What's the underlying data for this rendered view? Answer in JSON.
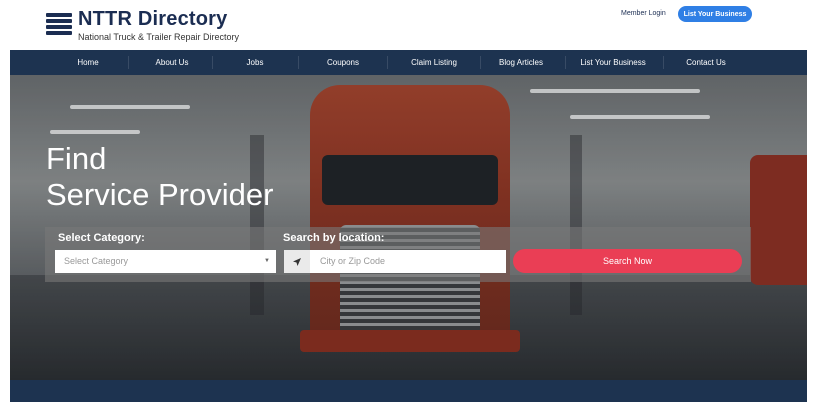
{
  "header": {
    "logo_title": "NTTR Directory",
    "logo_subtitle": "National Truck & Trailer Repair Directory",
    "member_login": "Member Login",
    "list_business_button": "List Your Business"
  },
  "nav": {
    "items": [
      {
        "label": "Home"
      },
      {
        "label": "About Us"
      },
      {
        "label": "Jobs"
      },
      {
        "label": "Coupons"
      },
      {
        "label": "Claim Listing"
      },
      {
        "label": "Blog Articles"
      },
      {
        "label": "List Your Business"
      },
      {
        "label": "Contact Us"
      }
    ]
  },
  "hero": {
    "title_line1": "Find",
    "title_line2": "Service Provider"
  },
  "search": {
    "category_label": "Select Category:",
    "category_selected": "Select Category",
    "location_label": "Search by location:",
    "location_placeholder": "City or Zip Code",
    "search_button": "Search Now"
  },
  "colors": {
    "brand_navy": "#1d3350",
    "accent_blue": "#2f7fe5",
    "search_red": "#ea3e55"
  },
  "icons": {
    "logo": "hamburger-lines-icon",
    "location": "location-arrow-icon",
    "dropdown": "caret-down-icon"
  }
}
